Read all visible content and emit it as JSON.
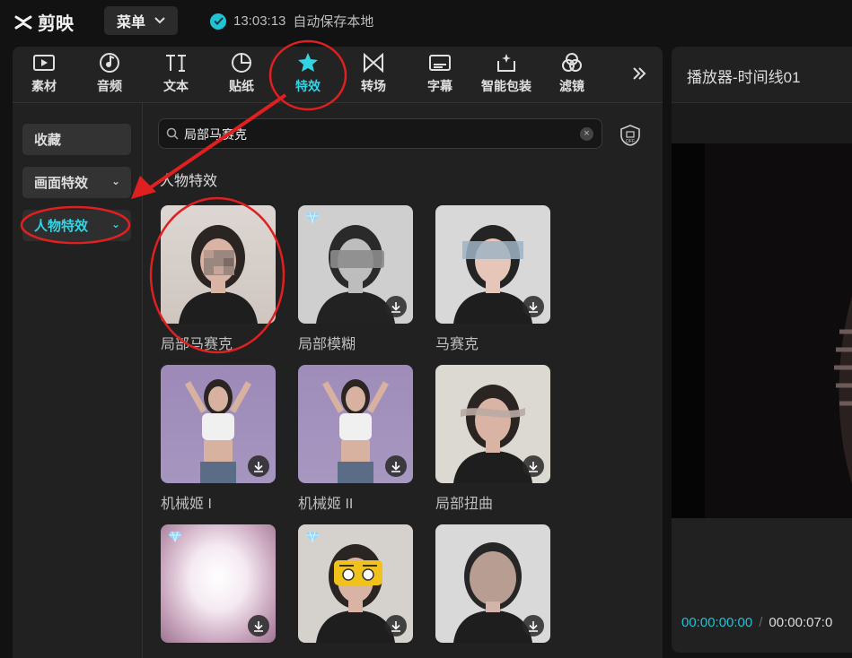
{
  "app": {
    "name": "剪映",
    "menu_label": "菜单"
  },
  "save_status": {
    "time": "13:03:13",
    "text": "自动保存本地"
  },
  "tabs": [
    {
      "label": "素材",
      "icon": "media-play-icon"
    },
    {
      "label": "音频",
      "icon": "audio-note-icon"
    },
    {
      "label": "文本",
      "icon": "text-icon"
    },
    {
      "label": "贴纸",
      "icon": "sticker-icon"
    },
    {
      "label": "特效",
      "icon": "star-effects-icon",
      "active": true
    },
    {
      "label": "转场",
      "icon": "transition-icon"
    },
    {
      "label": "字幕",
      "icon": "subtitle-icon"
    },
    {
      "label": "智能包装",
      "icon": "smart-package-icon"
    },
    {
      "label": "滤镜",
      "icon": "filter-icon"
    }
  ],
  "categories": [
    {
      "label": "收藏"
    },
    {
      "label": "画面特效"
    },
    {
      "label": "人物特效",
      "active": true
    }
  ],
  "search": {
    "value": "局部马赛克"
  },
  "section_title": "人物特效",
  "effects": [
    {
      "label": "局部马赛克",
      "vip": false,
      "download": false
    },
    {
      "label": "局部模糊",
      "vip": true,
      "download": true
    },
    {
      "label": "马赛克",
      "vip": false,
      "download": true
    },
    {
      "label": "机械姬 I",
      "vip": false,
      "download": true
    },
    {
      "label": "机械姬 II",
      "vip": false,
      "download": true
    },
    {
      "label": "局部扭曲",
      "vip": false,
      "download": true
    },
    {
      "label": "",
      "vip": true,
      "download": true
    },
    {
      "label": "",
      "vip": true,
      "download": true
    },
    {
      "label": "",
      "vip": false,
      "download": true
    }
  ],
  "player": {
    "title": "播放器-时间线01",
    "current_time": "00:00:00:00",
    "total_time": "00:00:07:0"
  },
  "colors": {
    "accent": "#34d3e2",
    "annotation": "#e02020",
    "background": "#121212",
    "panel": "#212121"
  }
}
